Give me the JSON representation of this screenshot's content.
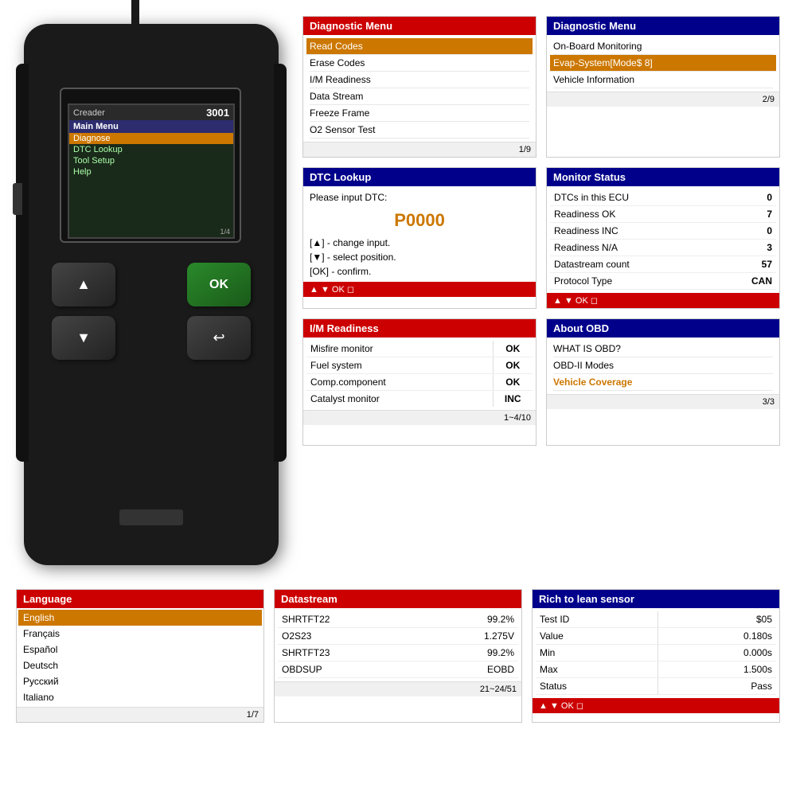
{
  "device": {
    "brand": "Creader",
    "model": "3001",
    "menu_title": "Main Menu",
    "menu_items": [
      {
        "label": "Diagnose",
        "active": true
      },
      {
        "label": "DTC Lookup",
        "active": false
      },
      {
        "label": "Tool Setup",
        "active": false
      },
      {
        "label": "Help",
        "active": false
      }
    ],
    "page": "1/4",
    "btn_ok": "OK"
  },
  "panels": {
    "diag_menu_1": {
      "title": "Diagnostic Menu",
      "items": [
        {
          "label": "Read Codes",
          "active": true
        },
        {
          "label": "Erase Codes",
          "active": false
        },
        {
          "label": "I/M Readiness",
          "active": false
        },
        {
          "label": "Data Stream",
          "active": false
        },
        {
          "label": "Freeze Frame",
          "active": false
        },
        {
          "label": "O2 Sensor Test",
          "active": false
        }
      ],
      "footer": "1/9"
    },
    "diag_menu_2": {
      "title": "Diagnostic Menu",
      "items": [
        {
          "label": "On-Board Monitoring",
          "active": false
        },
        {
          "label": "Evap-System[Mode$ 8]",
          "active": true
        },
        {
          "label": "Vehicle Information",
          "active": false
        }
      ],
      "footer": "2/9"
    },
    "dtc_lookup": {
      "title": "DTC Lookup",
      "prompt": "Please input DTC:",
      "code": "P0000",
      "instructions": [
        "[▲] - change input.",
        "[▼] - select position.",
        "[OK] - confirm."
      ],
      "nav": "▲ ▼ OK ◻"
    },
    "monitor_status": {
      "title": "Monitor Status",
      "rows": [
        {
          "label": "DTCs in this ECU",
          "value": "0"
        },
        {
          "label": "Readiness OK",
          "value": "7"
        },
        {
          "label": "Readiness INC",
          "value": "0"
        },
        {
          "label": "Readiness N/A",
          "value": "3"
        },
        {
          "label": "Datastream count",
          "value": "57"
        },
        {
          "label": "Protocol Type",
          "value": "CAN"
        }
      ],
      "nav": "▲ ▼ OK ◻"
    },
    "im_readiness": {
      "title": "I/M Readiness",
      "rows": [
        {
          "label": "Misfire monitor",
          "value": "OK"
        },
        {
          "label": "Fuel system",
          "value": "OK"
        },
        {
          "label": "Comp.component",
          "value": "OK"
        },
        {
          "label": "Catalyst monitor",
          "value": "INC"
        }
      ],
      "footer": "1~4/10"
    },
    "about_obd": {
      "title": "About OBD",
      "items": [
        {
          "label": "WHAT IS OBD?",
          "active": false
        },
        {
          "label": "OBD-II Modes",
          "active": false
        },
        {
          "label": "Vehicle Coverage",
          "active": true
        }
      ],
      "footer": "3/3"
    },
    "language": {
      "title": "Language",
      "items": [
        {
          "label": "English",
          "active": true
        },
        {
          "label": "Français",
          "active": false
        },
        {
          "label": "Español",
          "active": false
        },
        {
          "label": "Deutsch",
          "active": false
        },
        {
          "label": "Русский",
          "active": false
        },
        {
          "label": "Italiano",
          "active": false
        }
      ],
      "footer": "1/7"
    },
    "datastream": {
      "title": "Datastream",
      "rows": [
        {
          "label": "SHRTFT22",
          "value": "99.2%"
        },
        {
          "label": "O2S23",
          "value": "1.275V"
        },
        {
          "label": "SHRTFT23",
          "value": "99.2%"
        },
        {
          "label": "OBDSUP",
          "value": "EOBD"
        }
      ],
      "footer": "21~24/51"
    },
    "rich_lean": {
      "title": "Rich to lean sensor",
      "rows": [
        {
          "label": "Test ID",
          "value": "$05"
        },
        {
          "label": "Value",
          "value": "0.180s"
        },
        {
          "label": "Min",
          "value": "0.000s"
        },
        {
          "label": "Max",
          "value": "1.500s"
        },
        {
          "label": "Status",
          "value": "Pass"
        }
      ],
      "nav": "▲ ▼ OK ◻"
    }
  }
}
